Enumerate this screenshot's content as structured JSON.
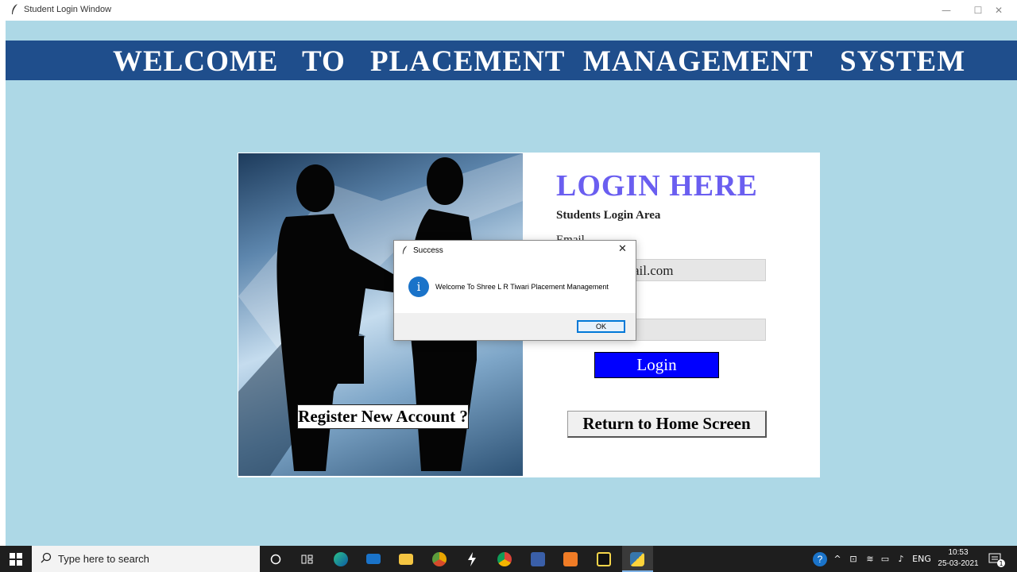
{
  "window": {
    "title": "Student Login Window",
    "controls": {
      "minimize": "—",
      "maximize": "☐",
      "close": "✕"
    }
  },
  "banner": {
    "words": [
      "WELCOME",
      "TO",
      "PLACEMENT",
      "MANAGEMENT",
      "SYSTEM"
    ],
    "color": "#1f4e8c"
  },
  "login": {
    "title": "LOGIN HERE",
    "subtitle": "Students Login Area",
    "email_label": "Email",
    "email_value_visible": "ail.com",
    "login_button": "Login",
    "home_button": "Return to Home Screen",
    "register_button": "Register New Account ?",
    "title_color": "#6a5ef0",
    "button_color": "#0000ff"
  },
  "dialog": {
    "title": "Success",
    "message": "Welcome To Shree L R Tiwari Placement Management",
    "ok_label": "OK",
    "close_glyph": "✕",
    "info_glyph": "i"
  },
  "taskbar": {
    "search_placeholder": "Type here to search",
    "language": "ENG",
    "time": "10:53",
    "date": "25-03-2021",
    "notification_count": "1",
    "icons": [
      "windows-start-icon",
      "cortana-icon",
      "task-view-icon",
      "edge-icon",
      "mail-icon",
      "file-explorer-icon",
      "chrome-canary-icon",
      "winamp-icon",
      "chrome-icon",
      "dev-cpp-icon",
      "xampp-icon",
      "pycharm-icon",
      "python-icon"
    ]
  },
  "background_color": "#add8e6"
}
